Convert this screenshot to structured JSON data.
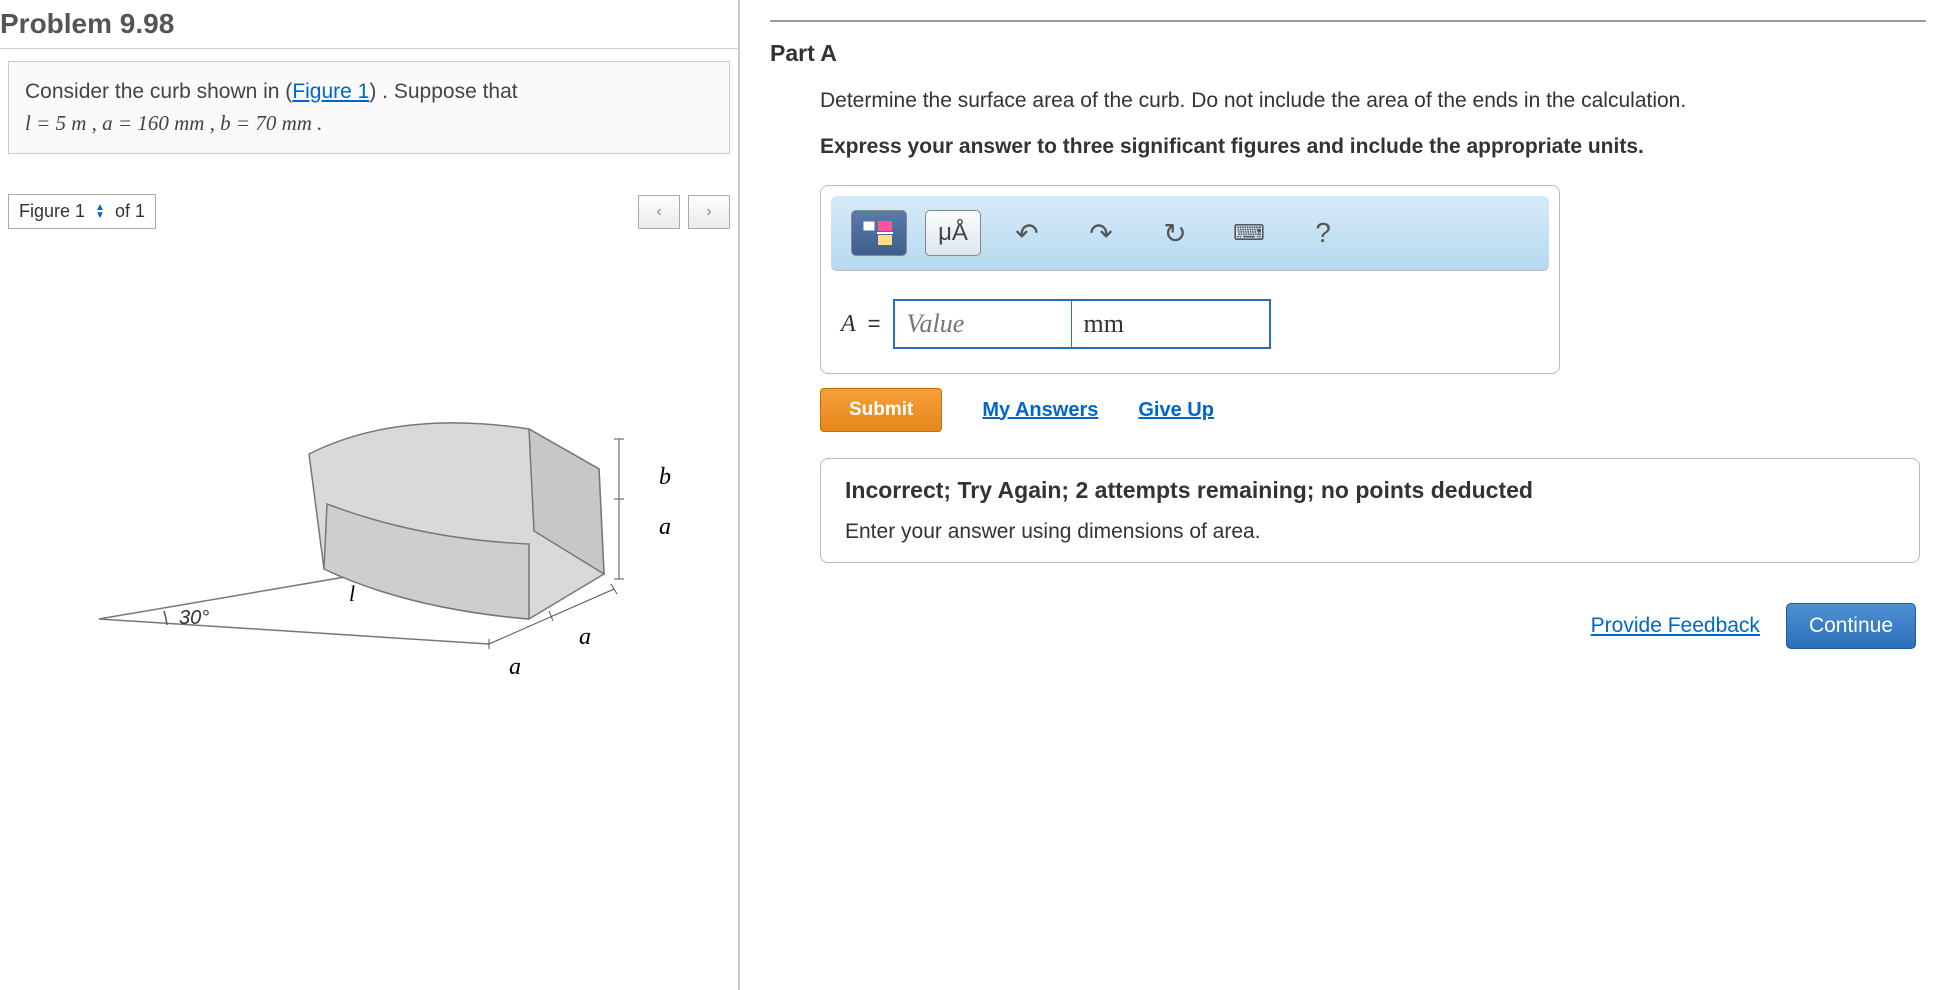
{
  "problem": {
    "title": "Problem 9.98",
    "prompt_pre": "Consider the curb shown in (",
    "figure_link": "Figure 1",
    "prompt_post": ") . Suppose that",
    "params": "l = 5  m , a = 160  mm , b = 70  mm ."
  },
  "figure": {
    "label": "Figure 1",
    "of_text": "of 1",
    "prev": "‹",
    "next": "›",
    "angle": "30°",
    "l": "l",
    "a": "a",
    "b": "b"
  },
  "partA": {
    "title": "Part A",
    "question": "Determine the surface area of the curb. Do not include the area of the ends in the calculation.",
    "instruction": "Express your answer to three significant figures and include the appropriate units.",
    "var": "A",
    "equals": "=",
    "value_placeholder": "Value",
    "units_value": "mm",
    "toolbar": {
      "units_tool": "μÅ",
      "help": "?"
    },
    "submit": "Submit",
    "my_answers": "My Answers",
    "give_up": "Give Up"
  },
  "feedback": {
    "title": "Incorrect; Try Again; 2 attempts remaining; no points deducted",
    "message": "Enter your answer using dimensions of area."
  },
  "footer": {
    "provide_feedback": "Provide Feedback",
    "continue": "Continue"
  }
}
